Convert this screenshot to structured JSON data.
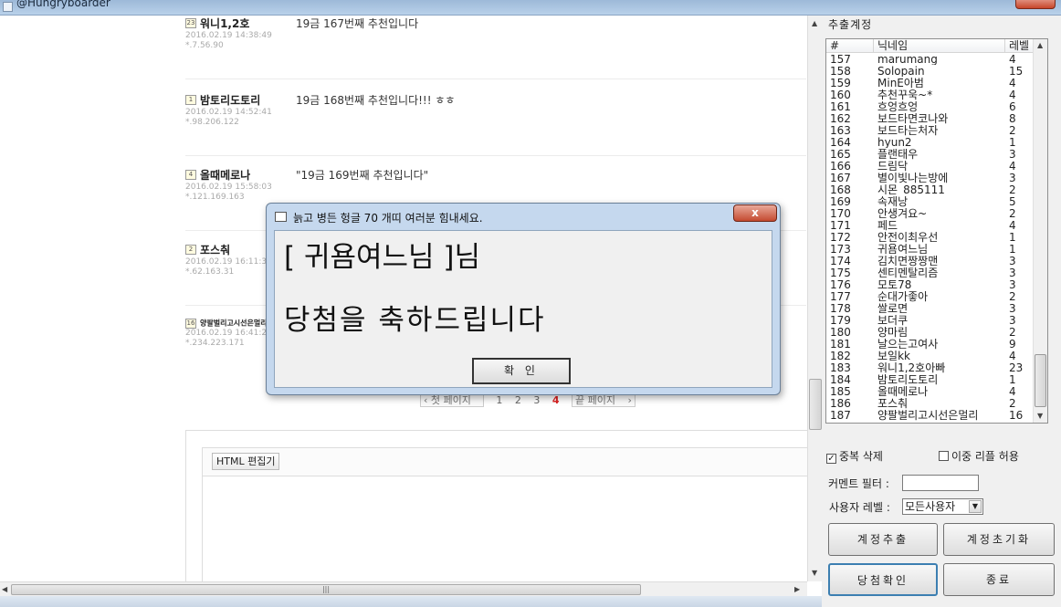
{
  "window": {
    "title": "@Hungryboarder"
  },
  "posts": [
    {
      "level": "23",
      "nick": "워니1,2호",
      "date": "2016.02.19 14:38:49",
      "ip": "*.7.56.90",
      "message": "19금 167번째 추천입니다"
    },
    {
      "level": "1",
      "nick": "밤토리도토리",
      "date": "2016.02.19 14:52:41",
      "ip": "*.98.206.122",
      "message": "19금 168번째 추천입니다!!! ㅎㅎ"
    },
    {
      "level": "4",
      "nick": "올때메로나",
      "date": "2016.02.19 15:58:03",
      "ip": "*.121.169.163",
      "message": "\"19금 169번째 추천입니다\""
    },
    {
      "level": "2",
      "nick": "포스춰",
      "date": "2016.02.19 16:11:33",
      "ip": "*.62.163.31",
      "message": ""
    },
    {
      "level": "16",
      "nick": "양팔벌리고시선은멀리",
      "date": "2016.02.19 16:41:24",
      "ip": "*.234.223.171",
      "message": ""
    }
  ],
  "pager": {
    "first": "첫 페이지",
    "pages": [
      "1",
      "2",
      "3",
      "4"
    ],
    "current": "4",
    "last": "끝 페이지"
  },
  "editor": {
    "html_button": "HTML 편집기"
  },
  "panel": {
    "title": "추출계정",
    "columns": {
      "no": "#",
      "nick": "닉네임",
      "level": "레벨"
    },
    "rows": [
      {
        "no": "157",
        "nick": "marumang",
        "level": "4"
      },
      {
        "no": "158",
        "nick": "Solopain",
        "level": "15"
      },
      {
        "no": "159",
        "nick": "MinE아범",
        "level": "4"
      },
      {
        "no": "160",
        "nick": "추천꾸욱~*",
        "level": "4"
      },
      {
        "no": "161",
        "nick": "흐엉흐엉",
        "level": "6"
      },
      {
        "no": "162",
        "nick": "보드타면코나와",
        "level": "8"
      },
      {
        "no": "163",
        "nick": "보드타는처자",
        "level": "2"
      },
      {
        "no": "164",
        "nick": "hyun2",
        "level": "1"
      },
      {
        "no": "165",
        "nick": "플랜태우",
        "level": "3"
      },
      {
        "no": "166",
        "nick": "드림닥",
        "level": "4"
      },
      {
        "no": "167",
        "nick": "별이빛나는방에",
        "level": "3"
      },
      {
        "no": "168",
        "nick": "시몬_885111",
        "level": "2"
      },
      {
        "no": "169",
        "nick": "속재낭",
        "level": "5"
      },
      {
        "no": "170",
        "nick": "안생겨요~",
        "level": "2"
      },
      {
        "no": "171",
        "nick": "페드",
        "level": "4"
      },
      {
        "no": "172",
        "nick": "안전이최우선",
        "level": "1"
      },
      {
        "no": "173",
        "nick": "귀욤여느님",
        "level": "1"
      },
      {
        "no": "174",
        "nick": "김치면짱짱맨",
        "level": "3"
      },
      {
        "no": "175",
        "nick": "센티멘탈리즘",
        "level": "3"
      },
      {
        "no": "176",
        "nick": "모토78",
        "level": "3"
      },
      {
        "no": "177",
        "nick": "순대가좋아",
        "level": "2"
      },
      {
        "no": "178",
        "nick": "쌀로면",
        "level": "3"
      },
      {
        "no": "179",
        "nick": "보더쿠",
        "level": "3"
      },
      {
        "no": "180",
        "nick": "양마림",
        "level": "2"
      },
      {
        "no": "181",
        "nick": "날으는고여사",
        "level": "9"
      },
      {
        "no": "182",
        "nick": "보일kk",
        "level": "4"
      },
      {
        "no": "183",
        "nick": "워니1,2호아빠",
        "level": "23"
      },
      {
        "no": "184",
        "nick": "밤토리도토리",
        "level": "1"
      },
      {
        "no": "185",
        "nick": "올때메로나",
        "level": "4"
      },
      {
        "no": "186",
        "nick": "포스춰",
        "level": "2"
      },
      {
        "no": "187",
        "nick": "양팔벌리고시선은멀리",
        "level": "16"
      }
    ],
    "dedupe_label": "중복 삭제",
    "dedupe_checked": true,
    "allow_double_label": "이중 리플 허용",
    "allow_double_checked": false,
    "comment_filter_label": "커멘트 필터 :",
    "comment_filter_value": "",
    "user_level_label": "사용자 레벨 :",
    "user_level_value": "모든사용자",
    "extract_button": "계정추출",
    "reset_button": "계정초기화",
    "winner_button": "당첨확인",
    "exit_button": "종료"
  },
  "dialog": {
    "title": "늙고 병든 헝글 70 개띠 여러분 힘내세요.",
    "line1": "[ 귀욤여느님 ]님",
    "line2": "당첨을 축하드립니다",
    "ok_button": "확 인",
    "close_glyph": "x"
  }
}
